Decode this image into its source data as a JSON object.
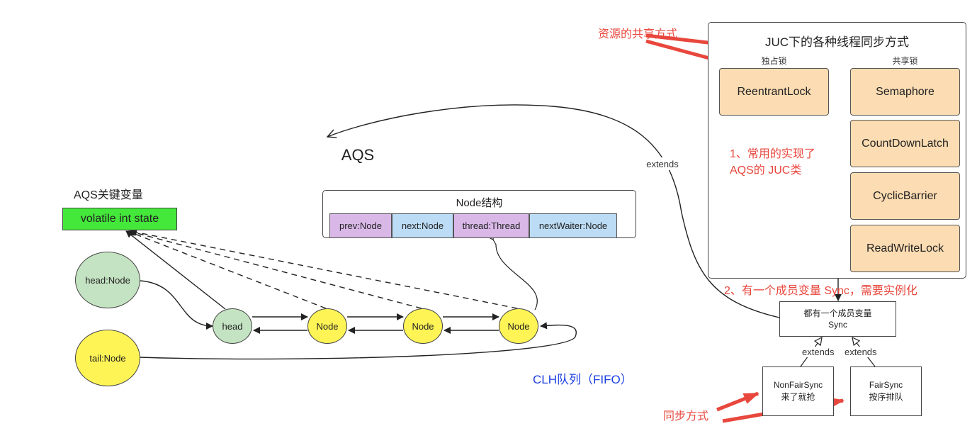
{
  "title_juc": "JUC下的各种线程同步方式",
  "label_exclusive": "独占锁",
  "label_shared": "共享锁",
  "locks": {
    "reentrant": "ReentrantLock",
    "semaphore": "Semaphore",
    "countdown": "CountDownLatch",
    "cyclic": "CyclicBarrier",
    "readwrite": "ReadWriteLock"
  },
  "note1": "1、常用的实现了\nAQS的 JUC类",
  "note2": "2、有一个成员变量 Sync，需要实例化",
  "annot_resource": "资源的共享方式",
  "annot_sync": "同步方式",
  "extends_main": "extends",
  "extends_left": "extends",
  "extends_right": "extends",
  "sync_box": "都有一个成员变量\nSync",
  "nonfair": "NonFairSync\n来了就抢",
  "fair": "FairSync\n按序排队",
  "aqs_title": "AQS",
  "aqs_vars_title": "AQS关键变量",
  "state_var": "volatile int state",
  "head_var": "head:Node",
  "tail_var": "tail:Node",
  "node_struct_title": "Node结构",
  "node_fields": [
    "prev:Node",
    "next:Node",
    "thread:Thread",
    "nextWaiter:Node"
  ],
  "queue_head": "head",
  "queue_nodes": [
    "Node",
    "Node",
    "Node"
  ],
  "clh_label": "CLH队列（FIFO）",
  "colors": {
    "lock_fill": "#fcdcb2",
    "state_fill": "#44e83a",
    "green_node": "#c4e3c2",
    "yellow_node": "#fff455",
    "prev_cell": "#d9b8e8",
    "next_cell": "#bcdcf5",
    "red": "#e8473d",
    "clh_blue": "#1a3fe0"
  }
}
